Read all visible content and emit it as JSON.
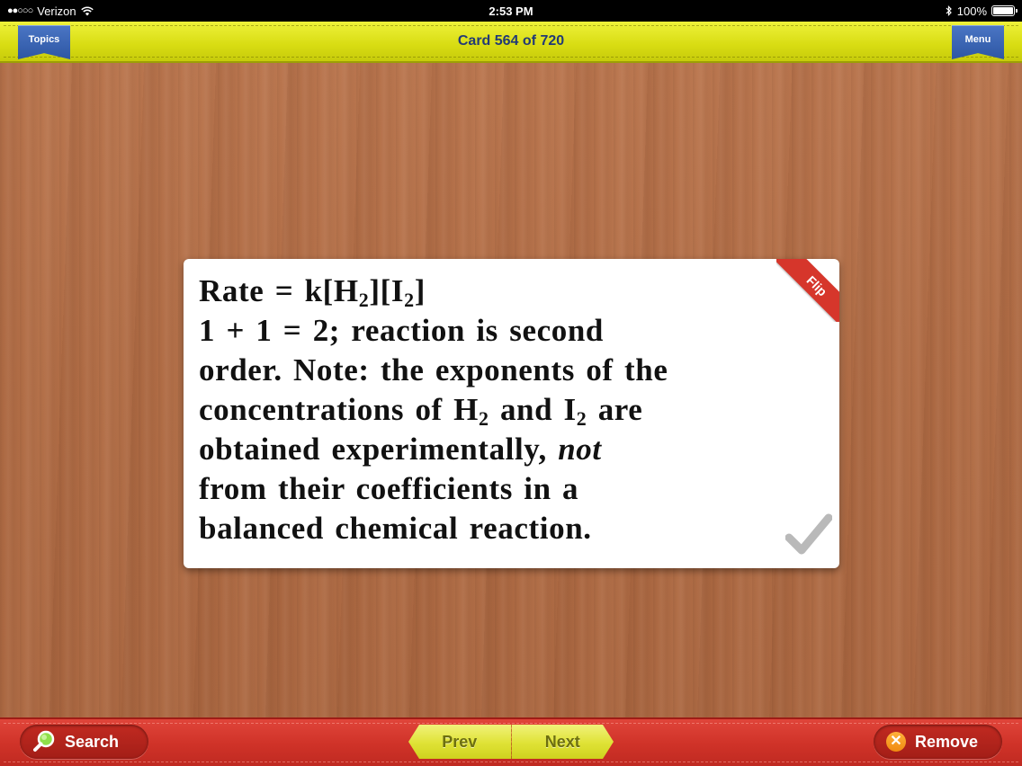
{
  "status_bar": {
    "signal": "●●○○○",
    "carrier": "Verizon",
    "time": "2:53 PM",
    "battery_label": "100%",
    "battery_level": 1.0
  },
  "top_bar": {
    "topics_label": "Topics",
    "title": "Card 564 of 720",
    "menu_label": "Menu"
  },
  "card": {
    "lines": [
      [
        "Rate = k[H",
        "2",
        "][I",
        "2",
        "]"
      ],
      [
        "1 + 1 = 2; reaction is second"
      ],
      [
        "order. Note: the exponents of the"
      ],
      [
        "concentrations of H",
        "2",
        " and I",
        "2",
        " are"
      ],
      [
        "obtained experimentally, ",
        "not"
      ],
      [
        "from their coefficients in a"
      ],
      [
        "balanced chemical reaction."
      ]
    ],
    "flip_label": "Flip"
  },
  "bottom_bar": {
    "search_label": "Search",
    "prev_label": "Prev",
    "next_label": "Next",
    "remove_label": "Remove"
  },
  "icons": {
    "search": "magnifier-icon",
    "remove": "close-circle-icon",
    "check": "checkmark-icon",
    "wifi": "wifi-icon",
    "bluetooth": "bluetooth-icon",
    "battery": "battery-icon"
  },
  "colors": {
    "top_bar": "#dcdf14",
    "bottom_bar": "#cf3228",
    "ribbon": "#2d56a3",
    "title_text": "#223a76",
    "flip_band": "#d6362b",
    "wood": "#b06c45"
  }
}
